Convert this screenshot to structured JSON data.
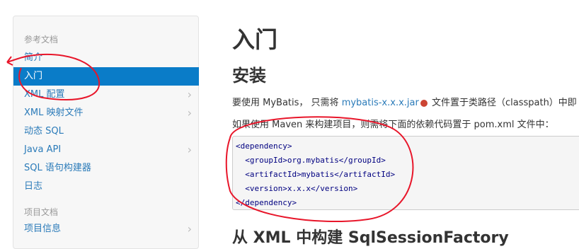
{
  "sidebar": {
    "section1_title": "参考文档",
    "items": [
      {
        "label": "简介",
        "active": false,
        "chevron": false
      },
      {
        "label": "入门",
        "active": true,
        "chevron": false
      },
      {
        "label": "XML 配置",
        "active": false,
        "chevron": true
      },
      {
        "label": "XML 映射文件",
        "active": false,
        "chevron": true
      },
      {
        "label": "动态 SQL",
        "active": false,
        "chevron": false
      },
      {
        "label": "Java API",
        "active": false,
        "chevron": true
      },
      {
        "label": "SQL 语句构建器",
        "active": false,
        "chevron": false
      },
      {
        "label": "日志",
        "active": false,
        "chevron": false
      }
    ],
    "section2_title": "项目文档",
    "items2": [
      {
        "label": "项目信息",
        "active": false,
        "chevron": true
      }
    ],
    "chevron_glyph": "›"
  },
  "main": {
    "title": "入门",
    "section_title": "安装",
    "para1_prefix": "要使用 MyBatis， 只需将 ",
    "para1_link": "mybatis-x.x.x.jar",
    "para1_suffix": " 文件置于类路径（classpath）中即",
    "para2": "如果使用 Maven 来构建项目，则需将下面的依赖代码置于 pom.xml 文件中：",
    "code_lines": [
      "<dependency>",
      "  <groupId>org.mybatis</groupId>",
      "  <artifactId>mybatis</artifactId>",
      "  <version>x.x.x</version>",
      "</dependency>"
    ],
    "next_heading": "从 XML 中构建 SqlSessionFactory"
  },
  "colors": {
    "active_bg": "#0a7cc8",
    "link": "#2b7bb9",
    "annotation": "#e8162a"
  }
}
